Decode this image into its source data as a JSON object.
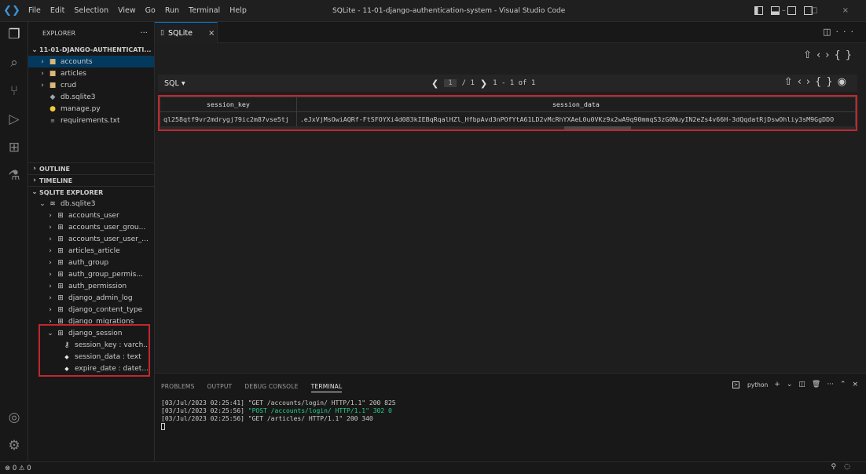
{
  "titlebar": {
    "logo": "❮❯",
    "menu": [
      "File",
      "Edit",
      "Selection",
      "View",
      "Go",
      "Run",
      "Terminal",
      "Help"
    ],
    "window_title": "SQLite - 11-01-django-authentication-system - Visual Studio Code",
    "controls": "–  □  ×"
  },
  "activity_bar": [
    "explorer-icon",
    "search-icon",
    "source-control-icon",
    "run-debug-icon",
    "extensions-icon",
    "testing-icon",
    "account-icon",
    "settings-gear-icon"
  ],
  "explorer": {
    "header": "EXPLORER",
    "more": "···",
    "project": "11-01-DJANGO-AUTHENTICATI...",
    "items": [
      {
        "name": "accounts",
        "type": "folder",
        "selected": true
      },
      {
        "name": "articles",
        "type": "folder"
      },
      {
        "name": "crud",
        "type": "folder"
      },
      {
        "name": "db.sqlite3",
        "type": "db"
      },
      {
        "name": "manage.py",
        "type": "python"
      },
      {
        "name": "requirements.txt",
        "type": "text"
      }
    ],
    "outline": "OUTLINE",
    "timeline": "TIMELINE"
  },
  "sqlite_explorer": {
    "header": "SQLITE EXPLORER",
    "database": "db.sqlite3",
    "tables": [
      "accounts_user",
      "accounts_user_grou...",
      "accounts_user_user_...",
      "articles_article",
      "auth_group",
      "auth_group_permis...",
      "auth_permission",
      "django_admin_log",
      "django_content_type",
      "django_migrations"
    ],
    "expanded_table": "django_session",
    "columns": [
      {
        "label": "session_key : varch...",
        "icon": "key-icon"
      },
      {
        "label": "session_data : text",
        "icon": "diamond-icon"
      },
      {
        "label": "expire_date : datet...",
        "icon": "diamond-icon"
      }
    ]
  },
  "tab": {
    "label": "SQLite",
    "close": "×"
  },
  "editor": {
    "sql_label": "SQL ▾",
    "pager": {
      "page": "1",
      "of_pages": "/ 1",
      "rows": "1 - 1 of 1",
      "prev": "❮",
      "next": "❯"
    },
    "table": {
      "headers": [
        "session_key",
        "session_data"
      ],
      "rows": [
        [
          "ql258qtf9vr2mdrygj79ic2m87vse5tj",
          ".eJxVjMsOwiAQRf-FtSFOYXi4d083kIEBqRqalHZl_HfbpAvd3nPOfYtA61LD2vMcRhYXAeL0u0VKz9x2wA9q90mmqS3zG0NuyIN2eZs4v66H-3dQqdatRjDswOhliy3sM9GgDDO"
        ]
      ]
    }
  },
  "panel": {
    "tabs": [
      "PROBLEMS",
      "OUTPUT",
      "DEBUG CONSOLE",
      "TERMINAL"
    ],
    "active_tab": "TERMINAL",
    "shell": "python",
    "terminal_lines": [
      {
        "prefix": "[03/Jul/2023 02:25:41] ",
        "text": "\"GET /accounts/login/ HTTP/1.1\" 200 825",
        "color": "#cccccc"
      },
      {
        "prefix": "[03/Jul/2023 02:25:56] ",
        "text": "\"POST /accounts/login/ HTTP/1.1\" 302 0",
        "color": "#23d18b"
      },
      {
        "prefix": "[03/Jul/2023 02:25:56] ",
        "text": "\"GET /articles/ HTTP/1.1\" 200 340",
        "color": "#cccccc"
      }
    ]
  },
  "statusbar": {
    "problems": "⊗ 0 ⚠ 0"
  },
  "colors": {
    "accent": "#0078d4",
    "highlight_box": "#c0282e",
    "folder": "#dcb67a"
  }
}
